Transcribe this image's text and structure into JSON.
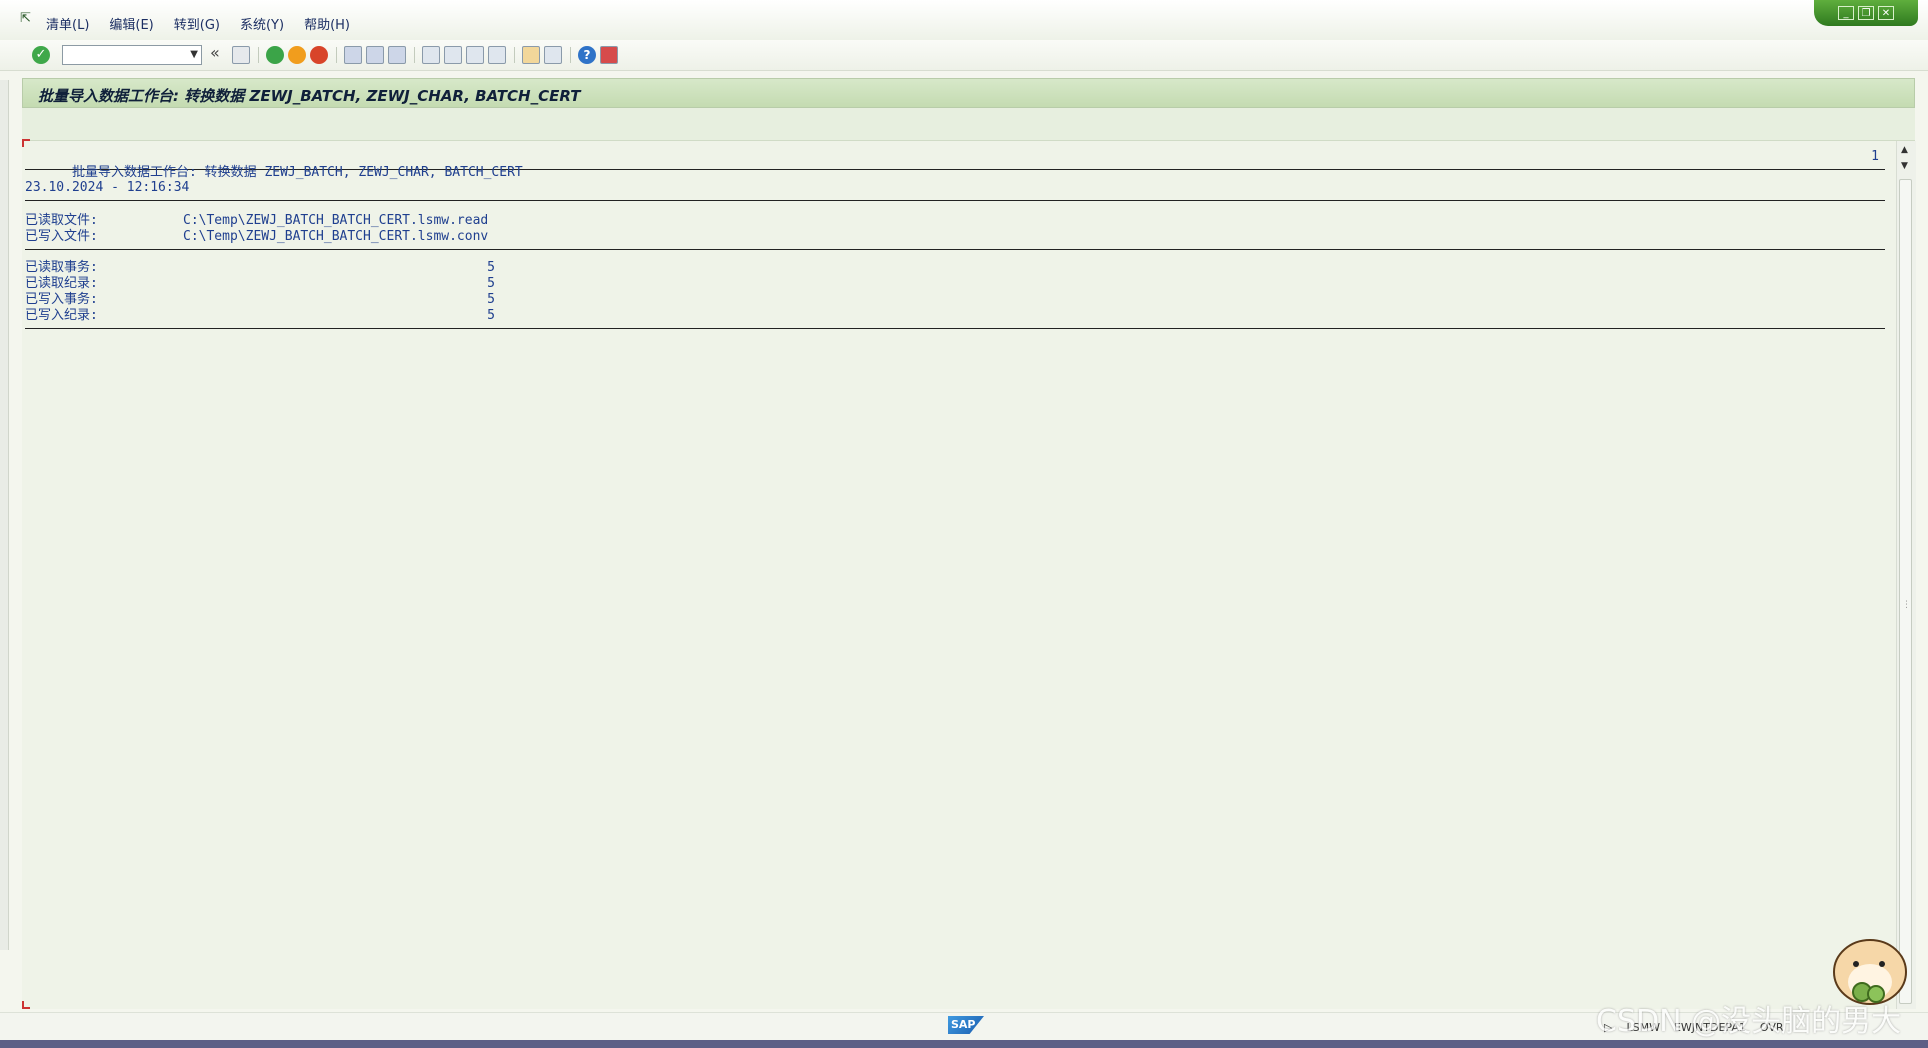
{
  "menu": {
    "items": [
      "清单(L)",
      "编辑(E)",
      "转到(G)",
      "系统(Y)",
      "帮助(H)"
    ]
  },
  "title": "批量导入数据工作台: 转换数据 ZEWJ_BATCH, ZEWJ_CHAR, BATCH_CERT",
  "list": {
    "heading": "批量导入数据工作台: 转换数据 ZEWJ_BATCH, ZEWJ_CHAR, BATCH_CERT",
    "page_number": "1",
    "timestamp": "23.10.2024 - 12:16:34",
    "files": [
      {
        "label": "已读取文件:",
        "value": "C:\\Temp\\ZEWJ_BATCH_BATCH_CERT.lsmw.read"
      },
      {
        "label": "已写入文件:",
        "value": "C:\\Temp\\ZEWJ_BATCH_BATCH_CERT.lsmw.conv"
      }
    ],
    "counts": [
      {
        "label": "已读取事务:",
        "value": "5"
      },
      {
        "label": "已读取纪录:",
        "value": "5"
      },
      {
        "label": "已写入事务:",
        "value": "5"
      },
      {
        "label": "已写入纪录:",
        "value": "5"
      }
    ]
  },
  "status": {
    "logo": "SAP",
    "transaction": "LSMW",
    "server": "EWJNTDEPA1",
    "mode": "OVR"
  },
  "watermark": "CSDN @没头脑的男大"
}
